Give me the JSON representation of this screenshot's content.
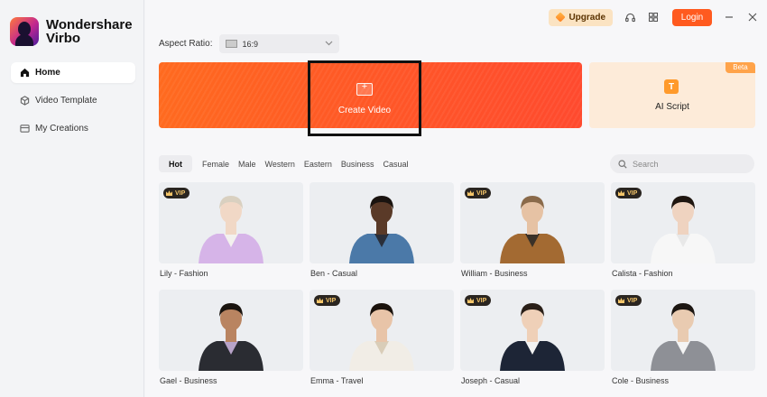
{
  "app": {
    "name_line1": "Wondershare",
    "name_line2": "Virbo"
  },
  "sidebar": {
    "items": [
      {
        "label": "Home",
        "active": true,
        "icon": "home-icon"
      },
      {
        "label": "Video Template",
        "active": false,
        "icon": "cube-icon"
      },
      {
        "label": "My Creations",
        "active": false,
        "icon": "folder-icon"
      }
    ]
  },
  "topbar": {
    "upgrade_label": "Upgrade",
    "login_label": "Login",
    "icons": [
      "headset-icon",
      "grid-icon",
      "minimize-icon",
      "close-icon"
    ]
  },
  "aspect": {
    "label": "Aspect Ratio:",
    "value": "16:9"
  },
  "create_video": {
    "label": "Create Video"
  },
  "ai_script": {
    "label": "AI Script",
    "badge": "Beta",
    "icon_glyph": "T"
  },
  "filters": [
    "Hot",
    "Female",
    "Male",
    "Western",
    "Eastern",
    "Business",
    "Casual"
  ],
  "search": {
    "placeholder": "Search"
  },
  "vip_label": "VIP",
  "avatars": [
    {
      "name": "Lily - Fashion",
      "vip": true,
      "hair": "#d9d0c0",
      "skin": "#f1d8c6",
      "top": "#d6b4e8",
      "bottom": "#f3f1ee"
    },
    {
      "name": "Ben - Casual",
      "vip": false,
      "hair": "#1a1410",
      "skin": "#5a3a28",
      "top": "#4b79a8",
      "bottom": "#2a2f3a"
    },
    {
      "name": "William - Business",
      "vip": true,
      "hair": "#8a6a4a",
      "skin": "#e6c2a4",
      "top": "#a36a32",
      "bottom": "#3a3128"
    },
    {
      "name": "Calista - Fashion",
      "vip": true,
      "hair": "#1f1610",
      "skin": "#efd3c0",
      "top": "#f7f7f7",
      "bottom": "#e8e8e8"
    },
    {
      "name": "Gael - Business",
      "vip": false,
      "hair": "#1a140f",
      "skin": "#b98461",
      "top": "#2a2c32",
      "bottom": "#b7a3c8"
    },
    {
      "name": "Emma - Travel",
      "vip": true,
      "hair": "#1a120c",
      "skin": "#e8c4a8",
      "top": "#f1ede6",
      "bottom": "#d9cdb8"
    },
    {
      "name": "Joseph - Casual",
      "vip": true,
      "hair": "#2a1f18",
      "skin": "#efd0b8",
      "top": "#1d2536",
      "bottom": "#f2f2f2"
    },
    {
      "name": "Cole - Business",
      "vip": true,
      "hair": "#1c1612",
      "skin": "#e9cbb1",
      "top": "#8e9096",
      "bottom": "#f4f4f4"
    }
  ]
}
